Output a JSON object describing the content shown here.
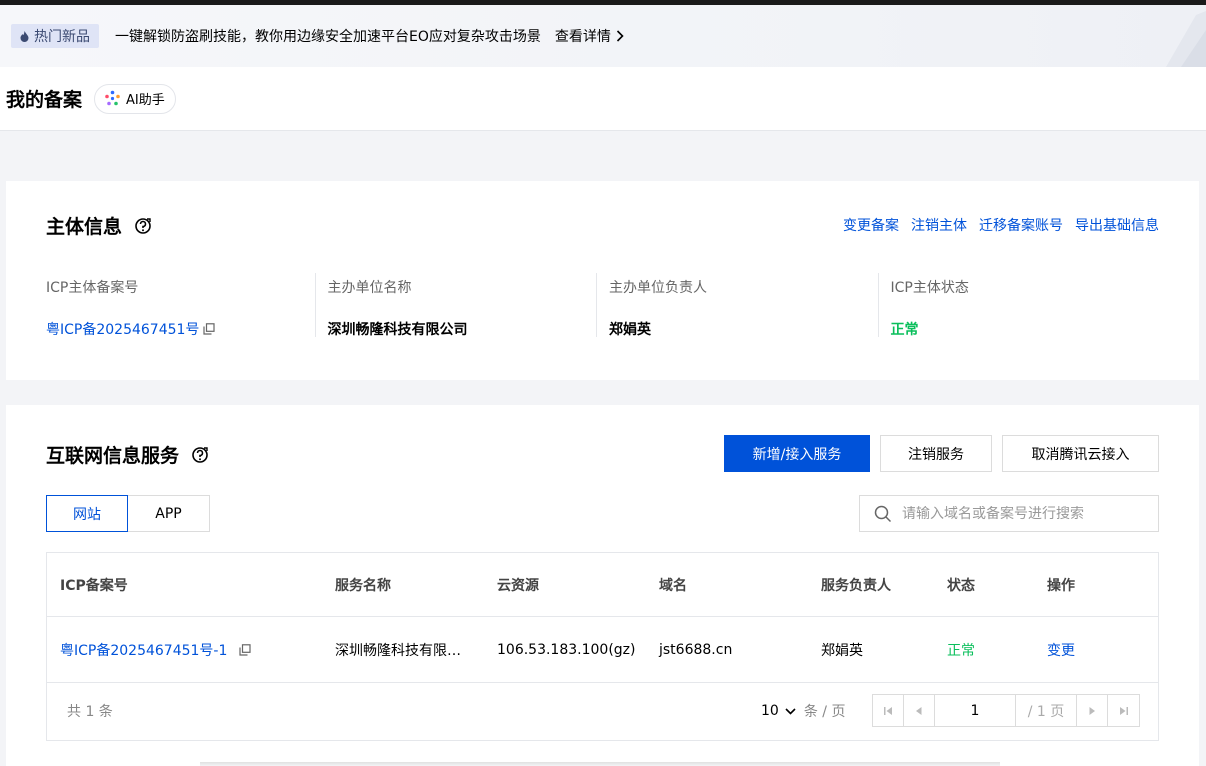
{
  "banner": {
    "tag_label": "热门新品",
    "text": "一键解锁防盗刷技能，教你用边缘安全加速平台EO应对复杂攻击场景",
    "link_label": "查看详情"
  },
  "header": {
    "title": "我的备案",
    "ai_button": "AI助手"
  },
  "subject": {
    "title": "主体信息",
    "actions": [
      "变更备案",
      "注销主体",
      "迁移备案账号",
      "导出基础信息"
    ],
    "fields": [
      {
        "label": "ICP主体备案号",
        "value": "粤ICP备2025467451号"
      },
      {
        "label": "主办单位名称",
        "value": "深圳畅隆科技有限公司"
      },
      {
        "label": "主办单位负责人",
        "value": "郑娟英"
      },
      {
        "label": "ICP主体状态",
        "value": "正常"
      }
    ]
  },
  "services": {
    "title": "互联网信息服务",
    "buttons": {
      "add": "新增/接入服务",
      "cancel": "注销服务",
      "unlink": "取消腾讯云接入"
    },
    "tabs": [
      "网站",
      "APP"
    ],
    "search_placeholder": "请输入域名或备案号进行搜索",
    "columns": [
      "ICP备案号",
      "服务名称",
      "云资源",
      "域名",
      "服务负责人",
      "状态",
      "操作"
    ],
    "rows": [
      {
        "icp": "粤ICP备2025467451号-1",
        "name": "深圳畅隆科技有限…",
        "resource": "106.53.183.100(gz)",
        "domain": "jst6688.cn",
        "owner": "郑娟英",
        "status": "正常",
        "action": "变更"
      }
    ],
    "footer": {
      "total": "共 1 条",
      "page_size": "10",
      "page_size_unit": "条 / 页",
      "current_page": "1",
      "total_pages": "/ 1 页"
    }
  },
  "colors": {
    "primary": "#0052d9",
    "success": "#0abf5b"
  }
}
